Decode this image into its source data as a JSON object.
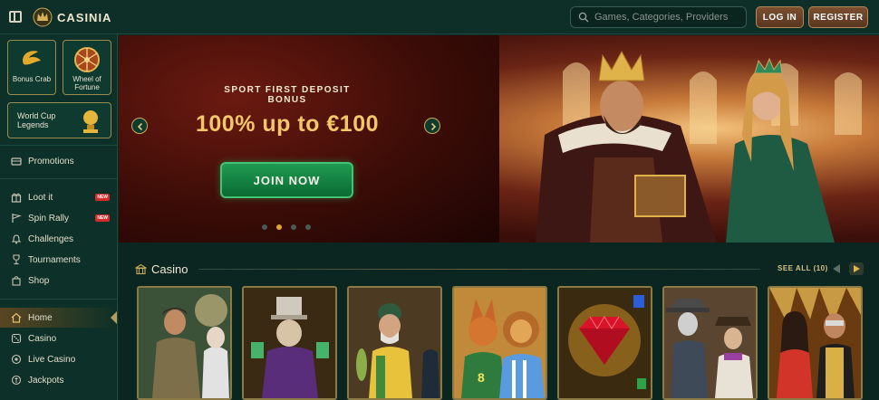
{
  "header": {
    "brand": "CASINIA",
    "search_placeholder": "Games, Categories, Providers",
    "login_label": "LOG IN",
    "register_label": "REGISTER"
  },
  "sidebar": {
    "tiles": [
      {
        "label": "Bonus Crab",
        "icon": "crab-claw-icon"
      },
      {
        "label": "Wheel of Fortune",
        "icon": "wheel-icon"
      }
    ],
    "world_cup": {
      "label": "World Cup Legends",
      "icon": "trophy-icon"
    },
    "items": [
      {
        "label": "Promotions",
        "icon": "promotions-icon",
        "badge": ""
      },
      {
        "label": "Loot it",
        "icon": "gift-box-icon",
        "badge": "NEW"
      },
      {
        "label": "Spin Rally",
        "icon": "flag-icon",
        "badge": "NEW"
      },
      {
        "label": "Challenges",
        "icon": "bell-icon",
        "badge": ""
      },
      {
        "label": "Tournaments",
        "icon": "trophy-icon",
        "badge": ""
      },
      {
        "label": "Shop",
        "icon": "shopping-bag-icon",
        "badge": ""
      },
      {
        "label": "Home",
        "icon": "home-icon",
        "badge": "",
        "active": true
      },
      {
        "label": "Casino",
        "icon": "casino-icon",
        "badge": ""
      },
      {
        "label": "Live Casino",
        "icon": "live-casino-icon",
        "badge": ""
      },
      {
        "label": "Jackpots",
        "icon": "jackpot-icon",
        "badge": ""
      }
    ]
  },
  "banner": {
    "subtitle": "SPORT FIRST DEPOSIT BONUS",
    "title": "100% up to €100",
    "cta_label": "JOIN NOW",
    "slide_count": 4,
    "active_slide": 2
  },
  "casino_section": {
    "title": "Casino",
    "see_all_label": "SEE ALL (10)",
    "games": [
      {
        "name": "explorer-game-tile"
      },
      {
        "name": "clown-magician-game-tile"
      },
      {
        "name": "fisherman-game-tile"
      },
      {
        "name": "football-animals-game-tile"
      },
      {
        "name": "ruby-diamond-game-tile"
      },
      {
        "name": "western-bandits-game-tile"
      },
      {
        "name": "couple-gold-game-tile"
      }
    ]
  },
  "colors": {
    "background": "#0c2a23",
    "accent_gold": "#c9a85a",
    "cta_green": "#1f9b52",
    "badge_red": "#d22b2b"
  }
}
